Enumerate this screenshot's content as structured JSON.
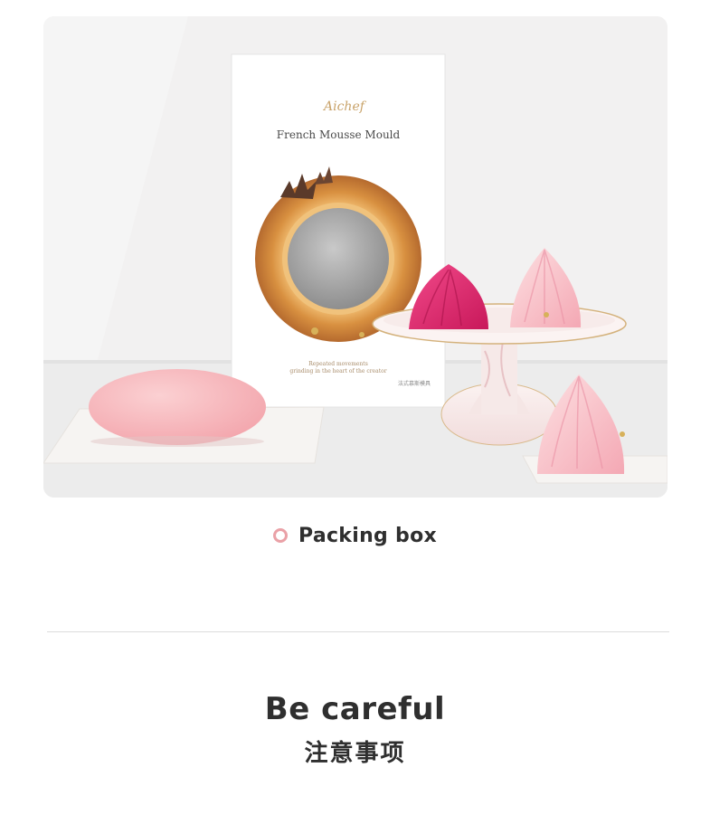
{
  "product_photo": {
    "box_brand": "Aichef",
    "box_title": "French Mousse Mould",
    "box_tagline_1": "Repeated movements",
    "box_tagline_2": "grinding in the heart of the creator",
    "box_zh_label": "法式慕斯模具"
  },
  "caption": {
    "text": "Packing box"
  },
  "notice": {
    "title_en": "Be careful",
    "title_zh": "注意事项"
  },
  "colors": {
    "accent_pink": "#eaa1a7",
    "text_dark": "#2f2f2f"
  }
}
